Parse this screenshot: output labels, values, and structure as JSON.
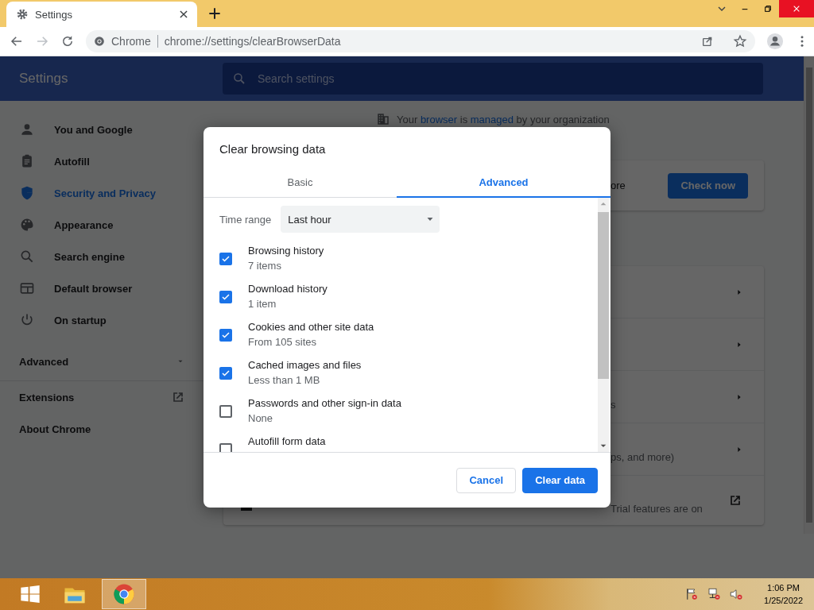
{
  "browser": {
    "tab": {
      "title": "Settings"
    },
    "omnibox": {
      "chip": "Chrome",
      "url": "chrome://settings/clearBrowserData"
    }
  },
  "settings_header": {
    "title": "Settings",
    "search": {
      "placeholder": "Search settings"
    }
  },
  "sidebar": {
    "items": [
      {
        "label": "You and Google",
        "selected": false
      },
      {
        "label": "Autofill",
        "selected": false
      },
      {
        "label": "Security and Privacy",
        "selected": true
      },
      {
        "label": "Appearance",
        "selected": false
      },
      {
        "label": "Search engine",
        "selected": false
      },
      {
        "label": "Default browser",
        "selected": false
      },
      {
        "label": "On startup",
        "selected": false
      }
    ],
    "advanced": {
      "label": "Advanced",
      "expanded": false
    },
    "links": [
      {
        "label": "Extensions",
        "kind": "external"
      },
      {
        "label": "About Chrome",
        "kind": "plain"
      }
    ]
  },
  "main": {
    "notice": [
      {
        "text": "Your ",
        "kind": "plain"
      },
      {
        "text": "browser",
        "kind": "link"
      },
      {
        "text": " is ",
        "kind": "plain"
      },
      {
        "text": "managed",
        "kind": "link"
      },
      {
        "text": " by your organization",
        "kind": "plain"
      }
    ],
    "safety_card": {
      "text": "ore",
      "button": "Check now"
    },
    "rows": [
      {
        "kind": "subpage"
      },
      {
        "kind": "subpage"
      },
      {
        "kind": "subpage",
        "detail": "s"
      },
      {
        "kind": "subpage",
        "detail": "ps, and more)"
      },
      {
        "kind": "external",
        "detail": "Trial features are on"
      }
    ]
  },
  "dialog": {
    "title": "Clear browsing data",
    "tabs": [
      {
        "label": "Basic",
        "selected": false
      },
      {
        "label": "Advanced",
        "selected": true
      }
    ],
    "time_range": {
      "label": "Time range",
      "value": "Last hour"
    },
    "items": [
      {
        "title": "Browsing history",
        "detail": "7 items",
        "checked": true
      },
      {
        "title": "Download history",
        "detail": "1 item",
        "checked": true
      },
      {
        "title": "Cookies and other site data",
        "detail": "From 105 sites",
        "checked": true
      },
      {
        "title": "Cached images and files",
        "detail": "Less than 1 MB",
        "checked": true
      },
      {
        "title": "Passwords and other sign-in data",
        "detail": "None",
        "checked": false
      },
      {
        "title": "Autofill form data",
        "checked": false
      }
    ],
    "buttons": [
      {
        "label": "Cancel",
        "kind": "secondary"
      },
      {
        "label": "Clear data",
        "kind": "primary"
      }
    ]
  },
  "taskbar": {
    "time": "1:06 PM",
    "date": "1/25/2022"
  }
}
